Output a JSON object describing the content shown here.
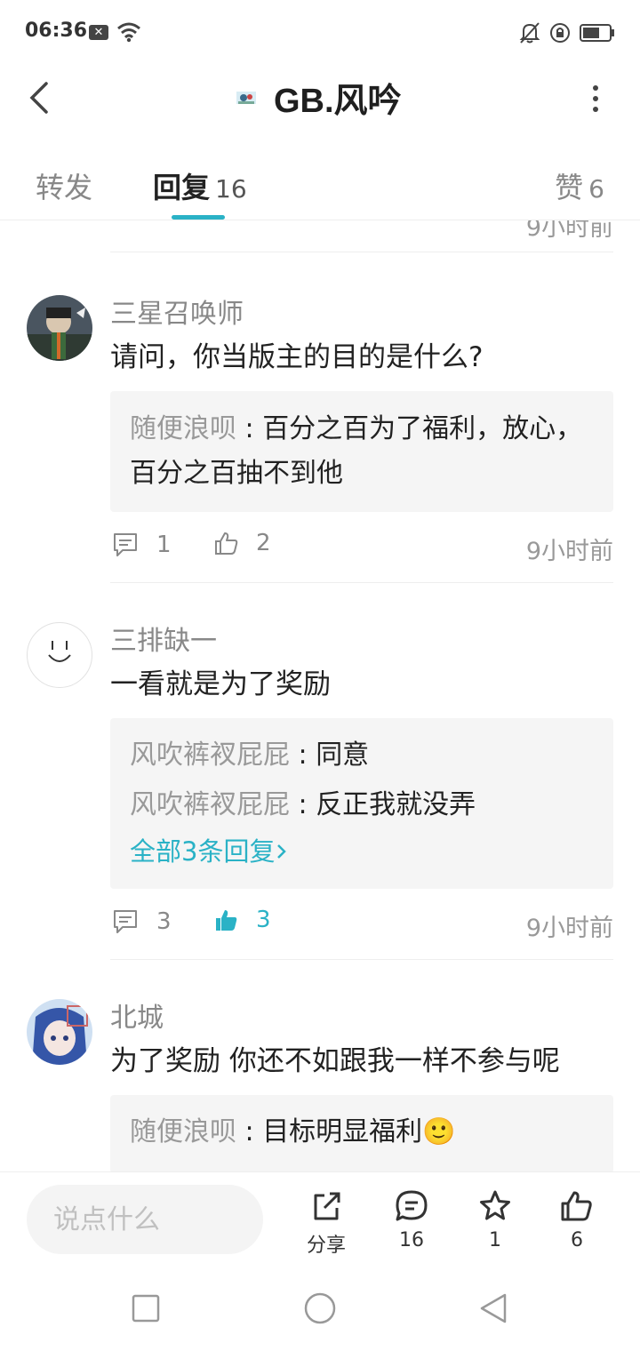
{
  "status": {
    "time": "06:36",
    "x_badge": "✕"
  },
  "header": {
    "title": "GB.风吟"
  },
  "tabs": {
    "forward_label": "转发",
    "reply_label": "回复",
    "reply_count": "16",
    "like_label": "赞",
    "like_count": "6"
  },
  "partial": {
    "time": "9小时前"
  },
  "comments": [
    {
      "user": "三星召唤师",
      "text": "请问，你当版主的目的是什么?",
      "replies": [
        {
          "author": "随便浪呗",
          "sep": " : ",
          "text": "百分之百为了福利，放心，百分之百抽不到他"
        }
      ],
      "reply_count": "1",
      "like_count": "2",
      "time": "9小时前"
    },
    {
      "user": "三排缺一",
      "text": "一看就是为了奖励",
      "replies": [
        {
          "author": "风吹裤衩屁屁",
          "sep": " : ",
          "text": "同意"
        },
        {
          "author": "风吹裤衩屁屁",
          "sep": " : ",
          "text": "反正我就没弄"
        }
      ],
      "more_replies": "全部3条回复",
      "reply_count": "3",
      "like_count": "3",
      "time": "9小时前"
    },
    {
      "user": "北城",
      "text": "为了奖励 你还不如跟我一样不参与呢",
      "replies": [
        {
          "author": "随便浪呗",
          "sep": " : ",
          "text": "目标明显福利🙂"
        }
      ]
    }
  ],
  "bottom": {
    "input_placeholder": "说点什么",
    "share_label": "分享",
    "comment_count": "16",
    "star_count": "1",
    "like_count": "6"
  },
  "colors": {
    "accent": "#2ab2c6",
    "text": "#222222",
    "muted": "#999999",
    "subbox": "#f5f5f5"
  }
}
